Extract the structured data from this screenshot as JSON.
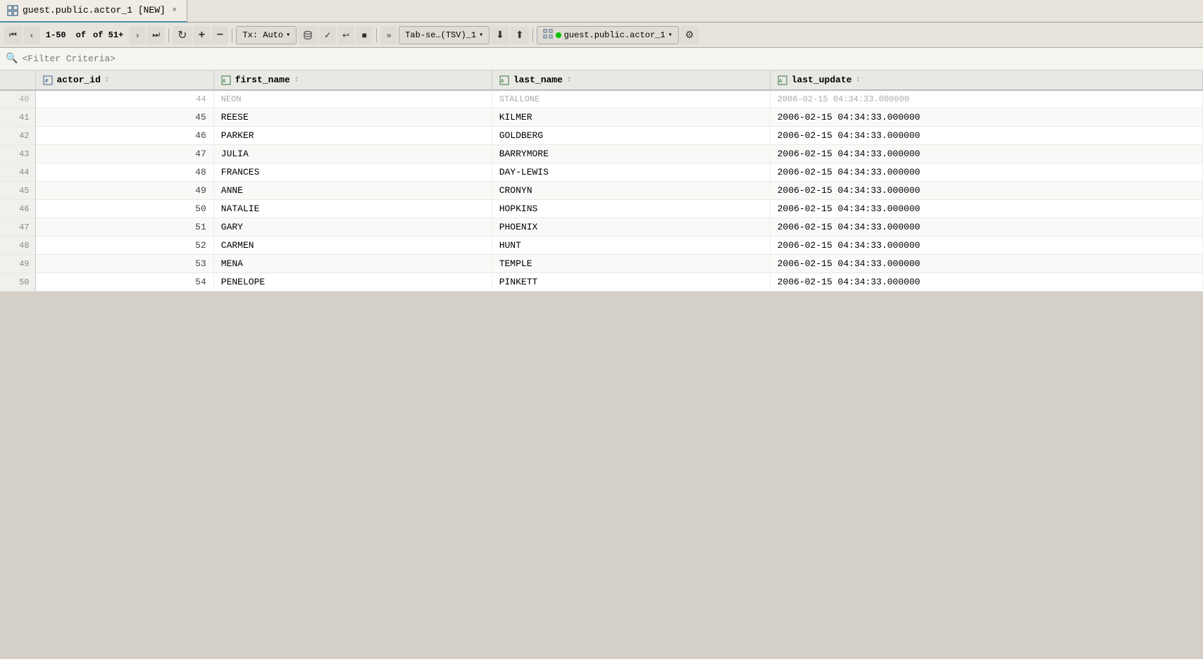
{
  "tab": {
    "icon": "grid-icon",
    "label": "guest.public.actor_1 [NEW]",
    "close_label": "×"
  },
  "toolbar": {
    "pagination": {
      "first_label": "⏮",
      "prev_label": "‹",
      "range_text": "1-50",
      "of_text": "of 51+",
      "next_label": "›",
      "last_label": "⏭"
    },
    "refresh_label": "↻",
    "add_label": "+",
    "remove_label": "−",
    "tx_label": "Tx: Auto",
    "db_icon": "db-icon",
    "confirm_label": "✓",
    "undo_label": "↩",
    "stop_label": "■",
    "more_label": "»",
    "format_label": "Tab-se…(TSV)_1",
    "download_label": "⬇",
    "upload_label": "⬆",
    "connection_label": "guest.public.actor_1",
    "settings_label": "⚙"
  },
  "filter": {
    "icon": "🔍",
    "placeholder": "<Filter Criteria>"
  },
  "columns": [
    {
      "name": "actor_id",
      "type": "num",
      "sort": "↕"
    },
    {
      "name": "first_name",
      "type": "str",
      "sort": "↕"
    },
    {
      "name": "last_name",
      "type": "str",
      "sort": "↕"
    },
    {
      "name": "last_update",
      "type": "str",
      "sort": "↕"
    }
  ],
  "partial_row": {
    "row_num": "40",
    "actor_id": "44",
    "first_name": "NEON",
    "last_name": "STALLONE",
    "last_update": "2006-02-15 04:34:33.000000"
  },
  "rows": [
    {
      "row_num": "41",
      "actor_id": "45",
      "first_name": "REESE",
      "last_name": "KILMER",
      "last_update": "2006-02-15 04:34:33.000000"
    },
    {
      "row_num": "42",
      "actor_id": "46",
      "first_name": "PARKER",
      "last_name": "GOLDBERG",
      "last_update": "2006-02-15 04:34:33.000000"
    },
    {
      "row_num": "43",
      "actor_id": "47",
      "first_name": "JULIA",
      "last_name": "BARRYMORE",
      "last_update": "2006-02-15 04:34:33.000000"
    },
    {
      "row_num": "44",
      "actor_id": "48",
      "first_name": "FRANCES",
      "last_name": "DAY-LEWIS",
      "last_update": "2006-02-15 04:34:33.000000"
    },
    {
      "row_num": "45",
      "actor_id": "49",
      "first_name": "ANNE",
      "last_name": "CRONYN",
      "last_update": "2006-02-15 04:34:33.000000"
    },
    {
      "row_num": "46",
      "actor_id": "50",
      "first_name": "NATALIE",
      "last_name": "HOPKINS",
      "last_update": "2006-02-15 04:34:33.000000"
    },
    {
      "row_num": "47",
      "actor_id": "51",
      "first_name": "GARY",
      "last_name": "PHOENIX",
      "last_update": "2006-02-15 04:34:33.000000"
    },
    {
      "row_num": "48",
      "actor_id": "52",
      "first_name": "CARMEN",
      "last_name": "HUNT",
      "last_update": "2006-02-15 04:34:33.000000"
    },
    {
      "row_num": "49",
      "actor_id": "53",
      "first_name": "MENA",
      "last_name": "TEMPLE",
      "last_update": "2006-02-15 04:34:33.000000"
    },
    {
      "row_num": "50",
      "actor_id": "54",
      "first_name": "PENELOPE",
      "last_name": "PINKETT",
      "last_update": "2006-02-15 04:34:33.000000"
    }
  ]
}
